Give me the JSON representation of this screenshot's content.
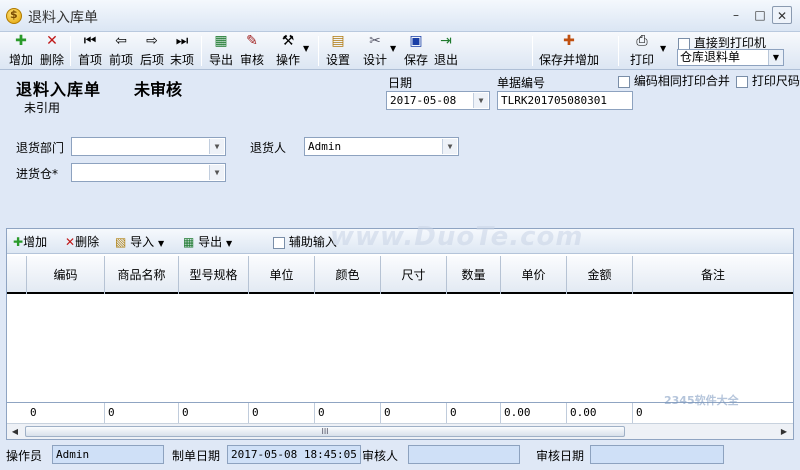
{
  "window": {
    "title": "退料入库单",
    "min": "–",
    "max": "□",
    "close": "✕"
  },
  "toolbar": {
    "add": "增加",
    "delete": "删除",
    "first": "首项",
    "prev": "前项",
    "next": "后项",
    "last": "末项",
    "export": "导出",
    "audit": "审核",
    "operate": "操作",
    "settings": "设置",
    "design": "设计",
    "save": "保存",
    "exit": "退出",
    "save_add": "保存并增加",
    "print": "打印",
    "direct_print": "直接到打印机",
    "print_template": "仓库退料单",
    "merge_print": "编码相同打印合并",
    "print_size": "打印尺码"
  },
  "header": {
    "title": "退料入库单",
    "status": "未审核",
    "ref_status": "未引用",
    "date_label": "日期",
    "date_value": "2017-05-08",
    "docno_label": "单据编号",
    "docno_value": "TLRK201705080301",
    "dept_label": "退货部门",
    "dept_value": "",
    "returner_label": "退货人",
    "returner_value": "Admin",
    "warehouse_label": "进货仓*",
    "warehouse_value": ""
  },
  "detail_toolbar": {
    "add": "增加",
    "delete": "删除",
    "import": "导入",
    "export": "导出",
    "aux_input": "辅助输入"
  },
  "grid": {
    "columns": [
      "编码",
      "商品名称",
      "型号规格",
      "单位",
      "颜色",
      "尺寸",
      "数量",
      "单价",
      "金额",
      "备注"
    ],
    "footer": [
      "0",
      "0",
      "0",
      "0",
      "0",
      "0",
      "0",
      "0.00",
      "0.00",
      "0"
    ]
  },
  "scroll_grip": "III",
  "status": {
    "operator_label": "操作员",
    "operator_value": "Admin",
    "date_label": "制单日期",
    "date_value": "2017-05-08 18:45:05",
    "auditor_label": "审核人",
    "auditor_value": "",
    "audit_date_label": "审核日期",
    "audit_date_value": ""
  },
  "watermark": "www.DuoTe.com",
  "watermark2": "2345软件大全"
}
